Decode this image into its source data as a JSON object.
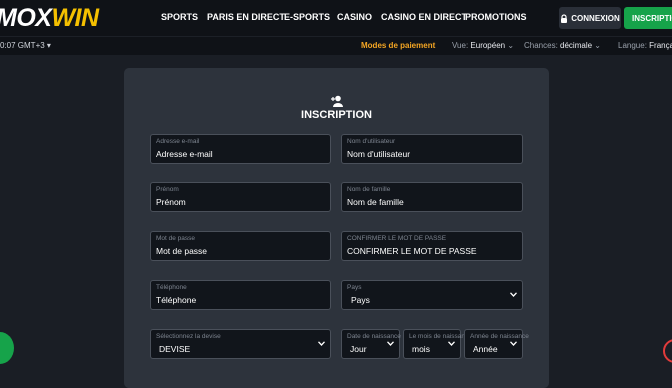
{
  "brand": {
    "logo_main": "MOX",
    "logo_accent": "WIN"
  },
  "nav": {
    "items": [
      "SPORTS",
      "PARIS EN DIRECT",
      "E-SPORTS",
      "CASINO",
      "CASINO EN DIRECT",
      "PROMOTIONS"
    ]
  },
  "header": {
    "login_label": "CONNEXION",
    "register_label": "INSCRIPTION"
  },
  "subbar": {
    "time": "0:07 GMT+3",
    "payment_modes": "Modes de paiement",
    "view_label": "Vue:",
    "view_value": "Européen",
    "odds_label": "Chances:",
    "odds_value": "décimale",
    "language_label": "Langue:",
    "language_value": "Français"
  },
  "form": {
    "title": "INSCRIPTION",
    "email": {
      "label": "Adresse e-mail",
      "value": "Adresse e-mail"
    },
    "username": {
      "label": "Nom d'utilisateur",
      "value": "Nom d'utilisateur"
    },
    "first_name": {
      "label": "Prénom",
      "value": "Prénom"
    },
    "last_name": {
      "label": "Nom de famille",
      "value": "Nom de famille"
    },
    "password": {
      "label": "Mot de passe",
      "value": "Mot de passe"
    },
    "confirm_password": {
      "label": "CONFIRMER LE MOT DE PASSE",
      "value": "CONFIRMER LE MOT DE PASSE"
    },
    "phone": {
      "label": "Téléphone",
      "value": "Téléphone"
    },
    "country": {
      "label": "Pays",
      "value": "Pays"
    },
    "currency": {
      "label": "Sélectionnez la devise",
      "value": "DEVISE"
    },
    "birth_day": {
      "label": "Date de naissance",
      "value": "Jour"
    },
    "birth_month": {
      "label": "Le mois de naissance",
      "value": "mois"
    },
    "birth_year": {
      "label": "Année de naissance",
      "value": "Année"
    }
  },
  "icons": {
    "lock": "lock-icon",
    "add_user": "add-user-icon",
    "chevron": "chevron-down-icon",
    "chat": "chat-icon",
    "support": "support-icon"
  },
  "colors": {
    "accent": "#f5c000",
    "register": "#16a34a",
    "payment": "#f5a623",
    "background": "#1a1e25",
    "card": "#2d333c",
    "field": "#11151b"
  }
}
